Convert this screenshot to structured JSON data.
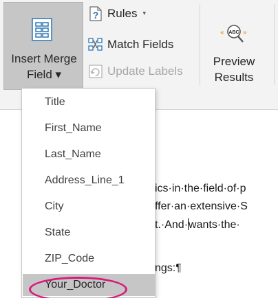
{
  "ribbon": {
    "insert_merge_field": {
      "line1": "Insert Merge",
      "line2": "Field ▾",
      "icon": "merge-field-grid-icon"
    },
    "rules": {
      "label": "Rules",
      "arrow": "▾",
      "icon": "rules-question-icon"
    },
    "match_fields": {
      "label": "Match Fields",
      "icon": "match-fields-icon"
    },
    "update_labels": {
      "label": "Update Labels",
      "icon": "update-labels-icon"
    },
    "preview_results": {
      "line1": "Preview",
      "line2": "Results",
      "icon": "abc-magnifier-icon"
    }
  },
  "menu": {
    "items": [
      {
        "label": "Title"
      },
      {
        "label": "First_Name"
      },
      {
        "label": "Last_Name"
      },
      {
        "label": "Address_Line_1"
      },
      {
        "label": "City"
      },
      {
        "label": "State"
      },
      {
        "label": "ZIP_Code"
      },
      {
        "label": "Your_Doctor"
      }
    ],
    "selected": "Your_Doctor"
  },
  "document": {
    "line1": "ics·in·the·field·of·p",
    "line2": "ffer·an·extensive·S",
    "line3a": "t.·And·",
    "line3b": "wants·the·",
    "line4": "ngs:¶"
  },
  "colors": {
    "ribbon_bg": "#f3f3f3",
    "pressed_bg": "#c6c6c6",
    "highlight_oval": "#d81b7e",
    "accent_blue": "#2e75b6",
    "accent_orange": "#e8a33d"
  }
}
